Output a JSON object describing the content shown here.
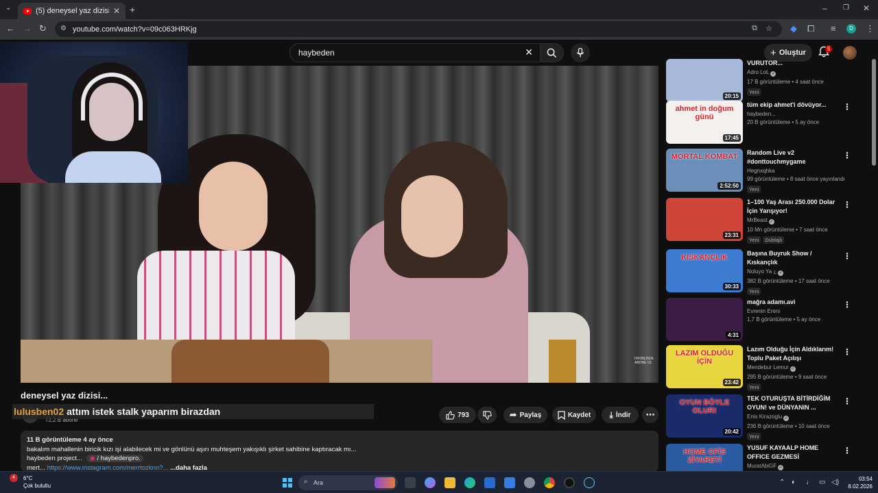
{
  "browser": {
    "tab_title": "(5) deneysel yaz dizisi... - YouTube",
    "url": "youtube.com/watch?v=09c063HRKjg",
    "profile_initial": "D"
  },
  "youtube_header": {
    "search_value": "haybeden",
    "create_label": "Oluştur",
    "notifications_count": "5"
  },
  "video": {
    "title": "deneysel yaz dizisi...",
    "watermark": "HAYBEDEN. ABONE OL",
    "channel_subs": "72,2 B abone",
    "like_count": "793",
    "share_label": "Paylaş",
    "save_label": "Kaydet",
    "download_label": "İndir"
  },
  "chat_overlay": {
    "username": "lulusben02",
    "message": "attım istek stalk yaparım birazdan"
  },
  "description": {
    "meta": "11 B görüntüleme  4 ay önce",
    "line1": "bakalım mahallenin biricik kızı işi alabilecek mi ve gönlünü aşırı muhteşem yakışıklı şirket sahibine kaptıracak mı...",
    "line2_prefix": "haybeden project...",
    "line2_handle": "/ haybedenpro.",
    "line3_prefix": "mert...",
    "line3_link": "https://www.instagram.com/merrtozknn?...",
    "more": "...daha fazla"
  },
  "recommendations": [
    {
      "title": "VURUTOR...",
      "channel": "Adro LoL",
      "verified": true,
      "meta": "17 B görüntüleme • 4 saat önce",
      "duration": "20:15",
      "badges": [
        "Yeni"
      ],
      "color": "#a8b8d8"
    },
    {
      "title": "tüm ekip ahmet'i dövüyor...",
      "channel": "haybeden...",
      "verified": false,
      "meta": "20 B görüntüleme • 5 ay önce",
      "duration": "17:45",
      "badges": [],
      "thumb_text": "ahmet in doğum günü",
      "color": "#f4f0ee"
    },
    {
      "title": "Random Live v2 #donttouchmygame",
      "channel": "Hegnxqhka",
      "verified": false,
      "meta": "99 görüntüleme • 8 saat önce yayınlandı",
      "duration": "2:52:50",
      "badges": [
        "Yeni"
      ],
      "thumb_text": "MORTAL KOMBAT",
      "color": "#6b8fb8"
    },
    {
      "title": "1–100 Yaş Arası 250.000 Dolar İçin Yarışıyor!",
      "channel": "MrBeast",
      "verified": true,
      "meta": "10 Mn görüntüleme • 7 saat önce",
      "duration": "23:31",
      "badges": [
        "Yeni",
        "Dublajlı"
      ],
      "color": "#d0453a"
    },
    {
      "title": "Başına Buyruk Show / Kıskançlık",
      "channel": "Noluyo Ya ¿",
      "verified": true,
      "meta": "382 B görüntüleme • 17 saat önce",
      "duration": "30:33",
      "badges": [
        "Yeni"
      ],
      "thumb_text": "KISKANÇLIK",
      "color": "#3c7bd0"
    },
    {
      "title": "mağra adamı.avi",
      "channel": "Evrenin Ereni",
      "verified": false,
      "meta": "1,7 B görüntüleme • 5 ay önce",
      "duration": "4:31",
      "badges": [],
      "color": "#3a1c44"
    },
    {
      "title": "Lazım Olduğu İçin Aldıklarım! Toplu Paket Açılışı",
      "channel": "Mendebur Lemur",
      "verified": true,
      "meta": "295 B görüntüleme • 9 saat önce",
      "duration": "23:42",
      "badges": [
        "Yeni"
      ],
      "thumb_text": "LAZIM OLDUĞU İÇİN",
      "color": "#e8d640"
    },
    {
      "title": "TEK OTURUŞTA BİTİRDİĞİM OYUN! ve DÜNYANIN ...",
      "channel": "Enis Kirazoglu",
      "verified": true,
      "meta": "236 B görüntüleme • 10 saat önce",
      "duration": "20:42",
      "badges": [
        "Yeni"
      ],
      "thumb_text": "OYUN BÖYLE OLUR!",
      "color": "#1a2a6a"
    },
    {
      "title": "YUSUF KAYAALP HOME OFFICE GEZMESİ @YusufKayaalp",
      "channel": "MuratAbiGF",
      "verified": true,
      "meta": "",
      "duration": "",
      "badges": [],
      "thumb_text": "HOME OFİS ZİYARETİ",
      "color": "#2a5aa0"
    }
  ],
  "taskbar": {
    "temperature": "6°C",
    "weather": "Çok bulutlu",
    "weather_badge": "4",
    "search_placeholder": "Ara",
    "time": "03:54",
    "date": "8.02.2026"
  }
}
